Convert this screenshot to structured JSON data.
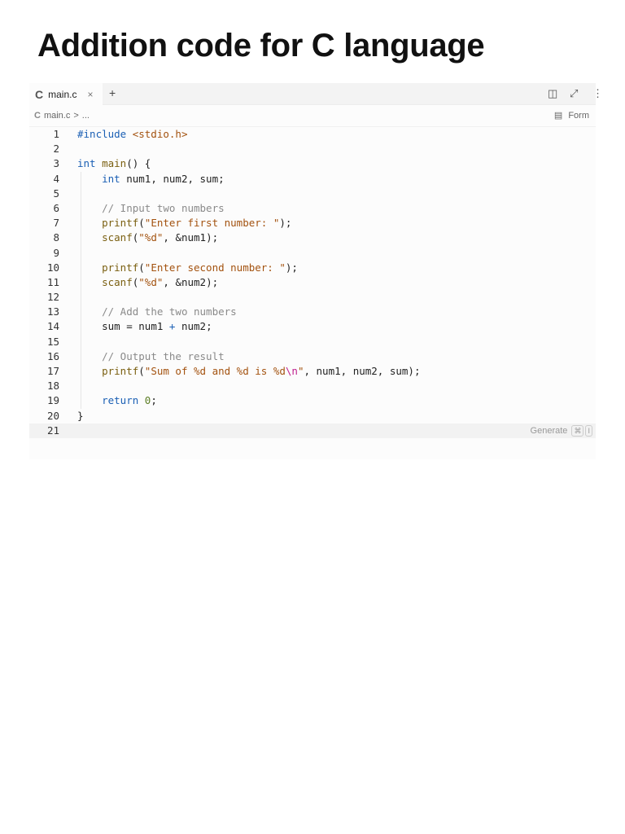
{
  "heading": "Addition code for C language",
  "editor": {
    "tab": {
      "logo": "C",
      "name": "main.c",
      "close": "×"
    },
    "new_tab": "+",
    "icons": {
      "split": "◫",
      "expand": "⤢",
      "more": "⋮"
    },
    "breadcrumb": {
      "logo": "C",
      "file": "main.c",
      "sep": ">",
      "rest": "..."
    },
    "format_label": "Form",
    "format_icon": "▤",
    "generate": {
      "label": "Generate",
      "key1": "⌘",
      "key2": "I"
    },
    "active_line": 21,
    "lines": [
      [
        {
          "t": "#include ",
          "c": "k"
        },
        {
          "t": "<stdio.h>",
          "c": "s"
        }
      ],
      [],
      [
        {
          "t": "int ",
          "c": "k"
        },
        {
          "t": "main",
          "c": "f"
        },
        {
          "t": "() {",
          "c": "p"
        }
      ],
      [
        {
          "t": "    "
        },
        {
          "t": "int ",
          "c": "k"
        },
        {
          "t": "num1, num2, sum;",
          "c": "p"
        }
      ],
      [],
      [
        {
          "t": "    "
        },
        {
          "t": "// Input two numbers",
          "c": "cm"
        }
      ],
      [
        {
          "t": "    "
        },
        {
          "t": "printf",
          "c": "f"
        },
        {
          "t": "(",
          "c": "p"
        },
        {
          "t": "\"Enter first number: \"",
          "c": "s"
        },
        {
          "t": ");",
          "c": "p"
        }
      ],
      [
        {
          "t": "    "
        },
        {
          "t": "scanf",
          "c": "f"
        },
        {
          "t": "(",
          "c": "p"
        },
        {
          "t": "\"%d\"",
          "c": "s"
        },
        {
          "t": ", &num1);",
          "c": "p"
        }
      ],
      [],
      [
        {
          "t": "    "
        },
        {
          "t": "printf",
          "c": "f"
        },
        {
          "t": "(",
          "c": "p"
        },
        {
          "t": "\"Enter second number: \"",
          "c": "s"
        },
        {
          "t": ");",
          "c": "p"
        }
      ],
      [
        {
          "t": "    "
        },
        {
          "t": "scanf",
          "c": "f"
        },
        {
          "t": "(",
          "c": "p"
        },
        {
          "t": "\"%d\"",
          "c": "s"
        },
        {
          "t": ", &num2);",
          "c": "p"
        }
      ],
      [],
      [
        {
          "t": "    "
        },
        {
          "t": "// Add the two numbers",
          "c": "cm"
        }
      ],
      [
        {
          "t": "    "
        },
        {
          "t": "sum = num1 ",
          "c": "p"
        },
        {
          "t": "+",
          "c": "k"
        },
        {
          "t": " num2;",
          "c": "p"
        }
      ],
      [],
      [
        {
          "t": "    "
        },
        {
          "t": "// Output the result",
          "c": "cm"
        }
      ],
      [
        {
          "t": "    "
        },
        {
          "t": "printf",
          "c": "f"
        },
        {
          "t": "(",
          "c": "p"
        },
        {
          "t": "\"Sum of %d and %d is %d",
          "c": "s"
        },
        {
          "t": "\\n",
          "c": "e"
        },
        {
          "t": "\"",
          "c": "s"
        },
        {
          "t": ", num1, num2, sum);",
          "c": "p"
        }
      ],
      [],
      [
        {
          "t": "    "
        },
        {
          "t": "return ",
          "c": "k"
        },
        {
          "t": "0",
          "c": "n"
        },
        {
          "t": ";",
          "c": "p"
        }
      ],
      [
        {
          "t": "}",
          "c": "p"
        }
      ],
      []
    ]
  }
}
